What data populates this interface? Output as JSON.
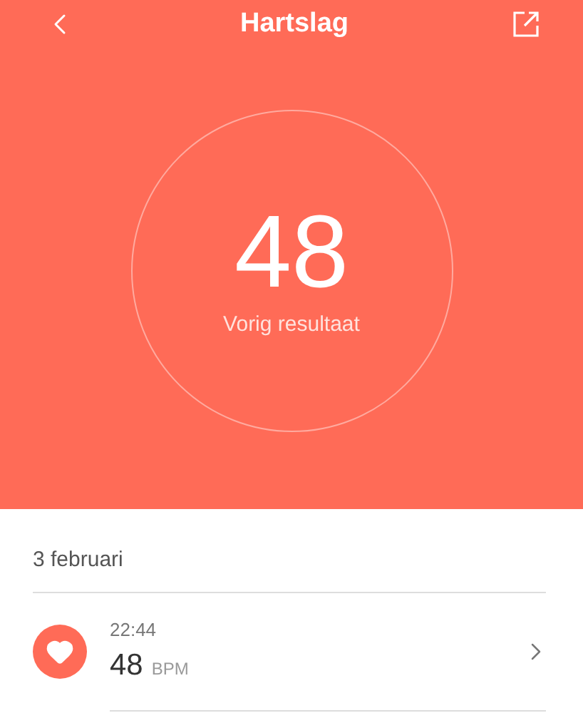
{
  "header": {
    "title": "Hartslag"
  },
  "result": {
    "value": "48",
    "label": "Vorig resultaat"
  },
  "date": "3 februari",
  "records": [
    {
      "time": "22:44",
      "value": "48",
      "unit": "BPM"
    }
  ]
}
